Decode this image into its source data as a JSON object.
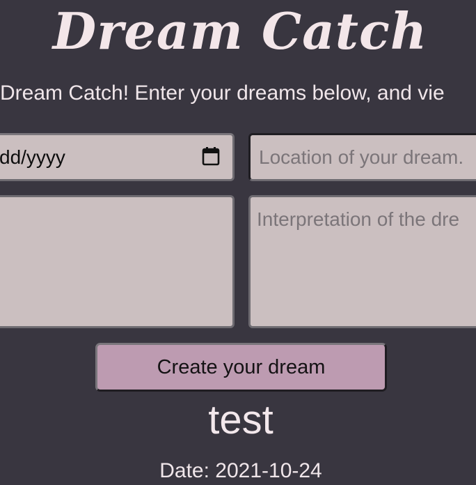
{
  "header": {
    "title": "Dream Catch",
    "intro": "Dream Catch! Enter your dreams below, and vie"
  },
  "form": {
    "date_value": "dd/yyyy",
    "date_icon": "calendar-icon",
    "location_placeholder": "Location of your dream.",
    "description_value": "",
    "interpretation_placeholder": "Interpretation of the dre",
    "submit_label": "Create your dream"
  },
  "dream": {
    "title": "test",
    "date_text": "Date: 2021-10-24"
  },
  "colors": {
    "background": "#393640",
    "input_background": "#cbbfc0",
    "button_background": "#bd9bb1",
    "title_text": "#f3e6e9"
  }
}
